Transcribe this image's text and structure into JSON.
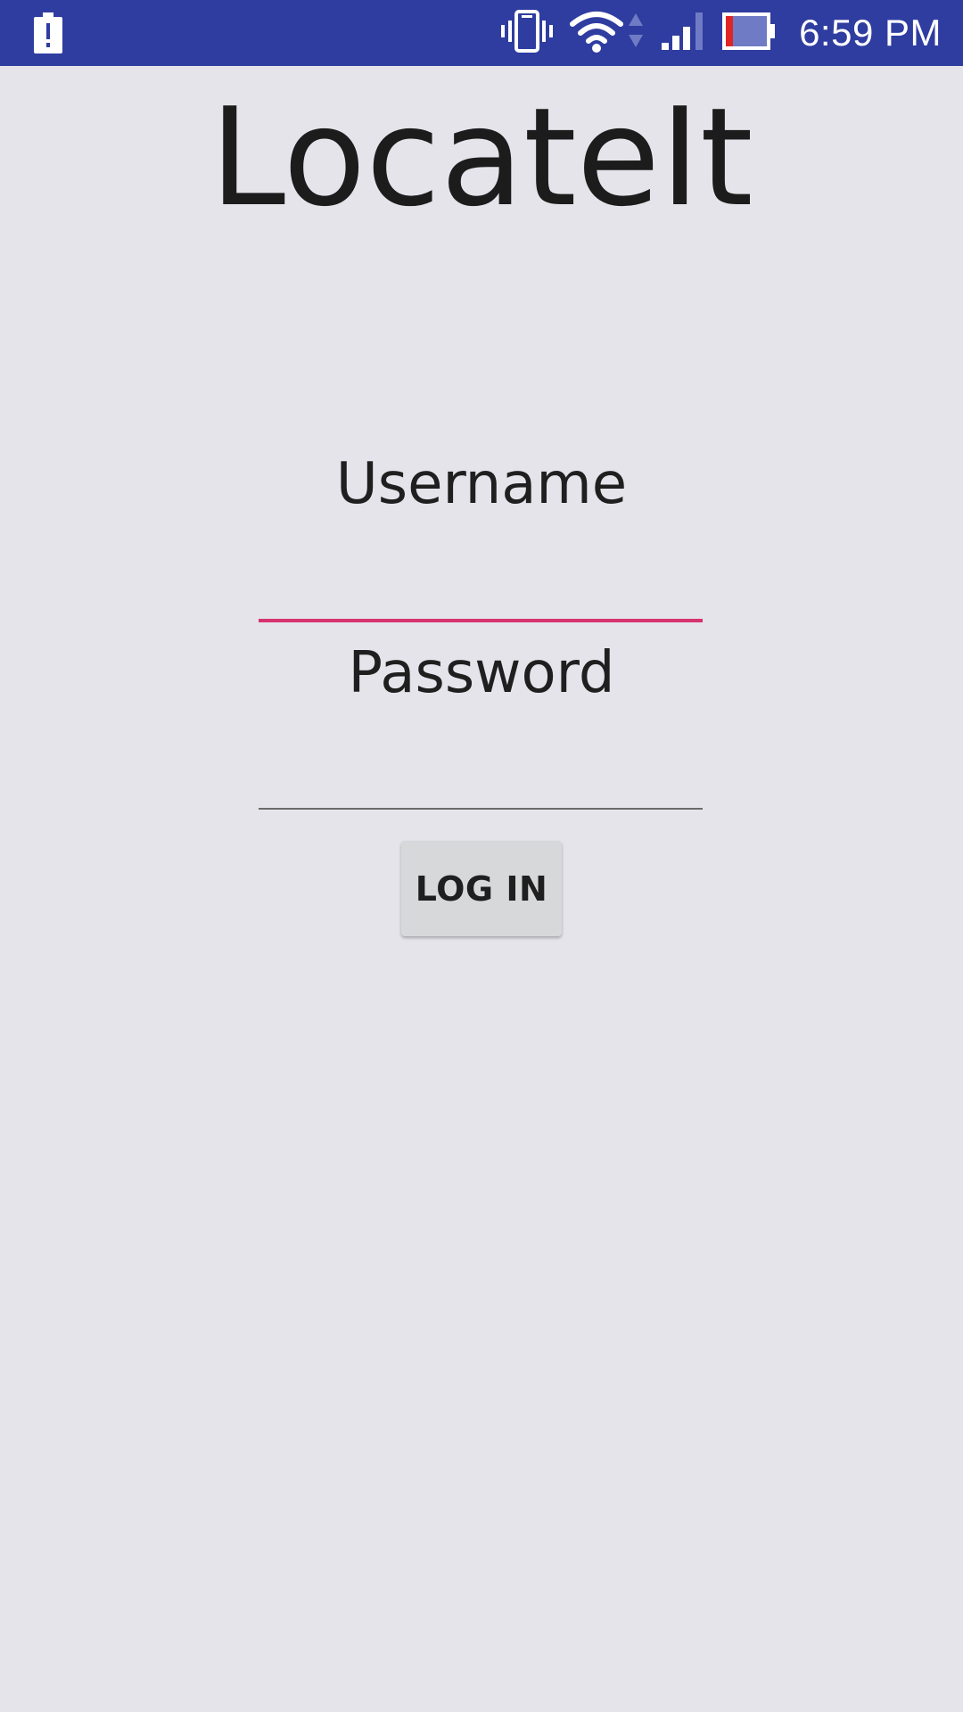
{
  "status_bar": {
    "time": "6:59 PM",
    "background_color": "#2f3da0",
    "icons": [
      "battery-alert-icon",
      "vibrate-icon",
      "wifi-icon",
      "data-arrows-icon",
      "cell-signal-icon",
      "battery-icon"
    ]
  },
  "app": {
    "title": "LocateIt"
  },
  "form": {
    "username_label": "Username",
    "username_value": "",
    "password_label": "Password",
    "password_value": "",
    "login_button_label": "LOG IN",
    "focused_underline_color": "#d6336e",
    "underline_color": "#6b6b6b"
  },
  "colors": {
    "background": "#e5e4eb",
    "button_background": "#d7d8d9"
  }
}
